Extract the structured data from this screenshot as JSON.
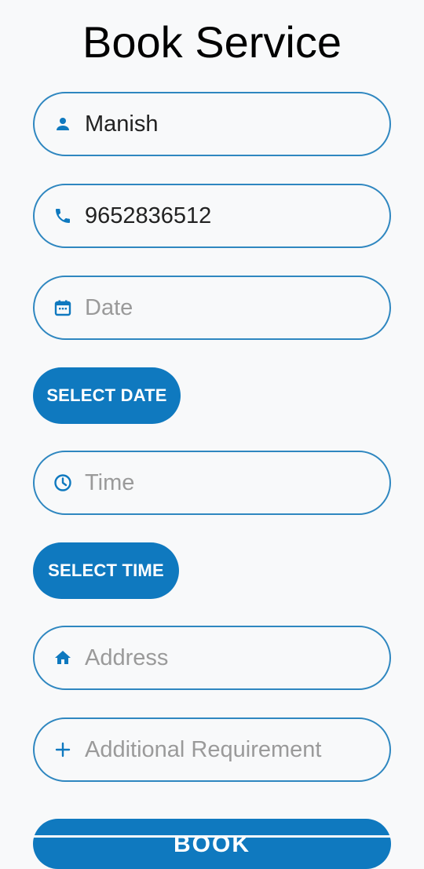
{
  "page": {
    "title": "Book Service"
  },
  "form": {
    "name": {
      "value": "Manish",
      "icon": "person-icon"
    },
    "phone": {
      "value": "9652836512",
      "icon": "phone-icon"
    },
    "date": {
      "placeholder": "Date",
      "icon": "calendar-icon"
    },
    "time": {
      "placeholder": "Time",
      "icon": "clock-icon"
    },
    "address": {
      "placeholder": "Address",
      "icon": "home-icon"
    },
    "additional_requirement": {
      "placeholder": "Additional Requirement",
      "icon": "plus-icon"
    }
  },
  "buttons": {
    "select_date": "SELECT DATE",
    "select_time": "SELECT TIME",
    "book": "BOOK"
  },
  "colors": {
    "accent": "#0f79bf",
    "field_border": "#2f87c0",
    "background": "#f8f9fa",
    "placeholder": "#9a9a9a"
  }
}
